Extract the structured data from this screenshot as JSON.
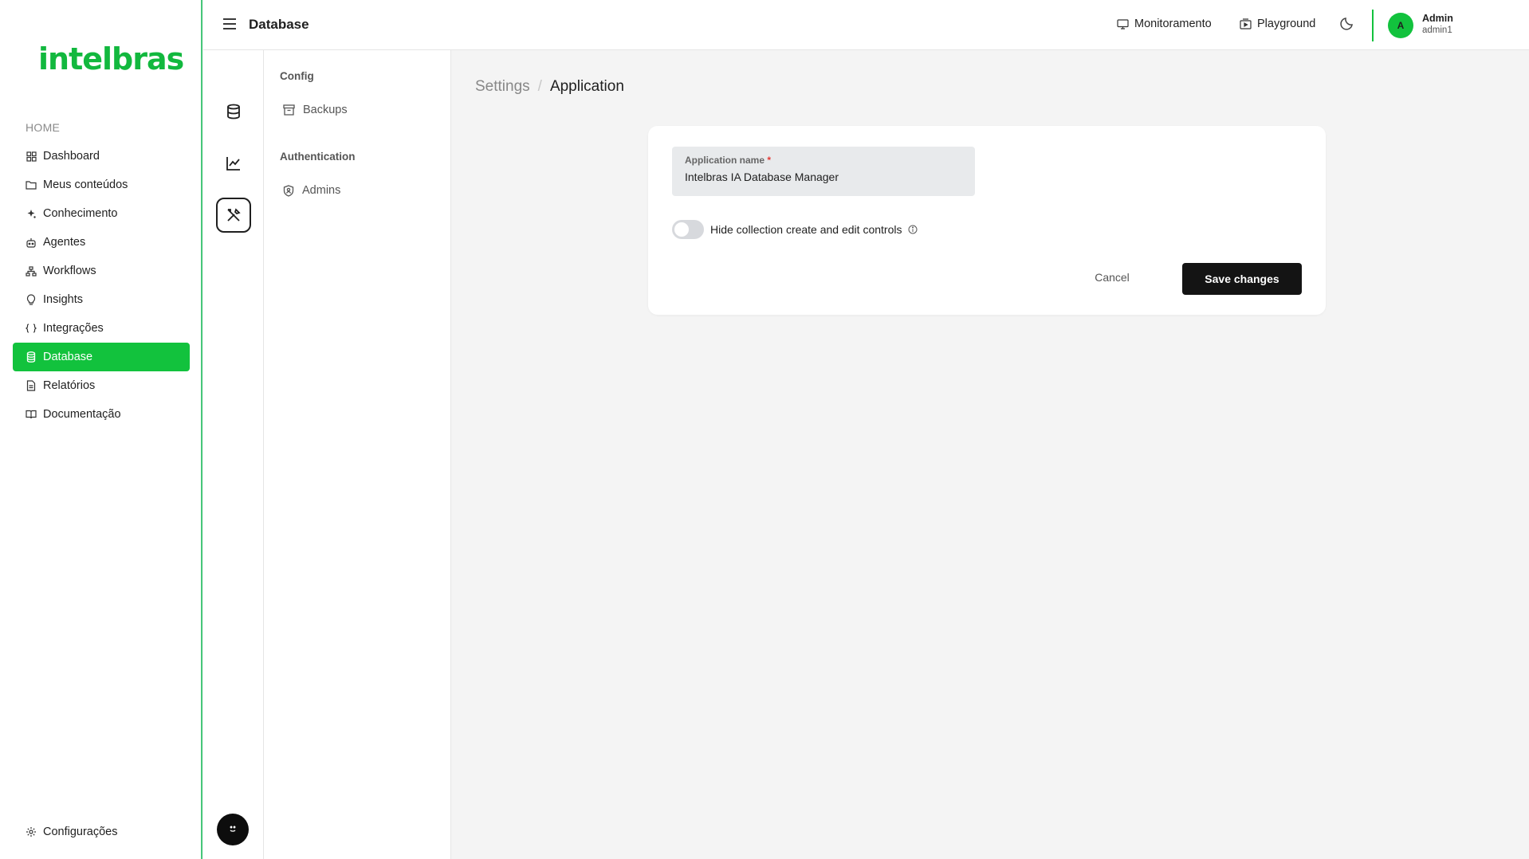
{
  "brand": {
    "logo_text": "intelbras",
    "accent": "#12c23d"
  },
  "sidebar": {
    "section": "HOME",
    "items": [
      {
        "label": "Dashboard",
        "icon": "grid-icon"
      },
      {
        "label": "Meus conteúdos",
        "icon": "folder-icon"
      },
      {
        "label": "Conhecimento",
        "icon": "sparkle-icon"
      },
      {
        "label": "Agentes",
        "icon": "robot-icon"
      },
      {
        "label": "Workflows",
        "icon": "workflow-icon"
      },
      {
        "label": "Insights",
        "icon": "lightbulb-icon"
      },
      {
        "label": "Integrações",
        "icon": "braces-icon"
      },
      {
        "label": "Database",
        "icon": "database-icon",
        "active": true
      },
      {
        "label": "Relatórios",
        "icon": "document-icon"
      },
      {
        "label": "Documentação",
        "icon": "book-icon"
      }
    ],
    "settings_label": "Configurações"
  },
  "header": {
    "title": "Database",
    "monitoring": "Monitoramento",
    "playground": "Playground",
    "user": {
      "initial": "A",
      "name": "Admin",
      "username": "admin1"
    }
  },
  "subnav": {
    "config_heading": "Config",
    "backups": "Backups",
    "auth_heading": "Authentication",
    "admins": "Admins"
  },
  "breadcrumb": {
    "root": "Settings",
    "separator": "/",
    "current": "Application"
  },
  "form": {
    "app_name_label": "Application name",
    "required_mark": "*",
    "app_name_value": "Intelbras IA Database Manager",
    "toggle_label": "Hide collection create and edit controls",
    "toggle_on": false,
    "cancel": "Cancel",
    "save": "Save changes"
  }
}
